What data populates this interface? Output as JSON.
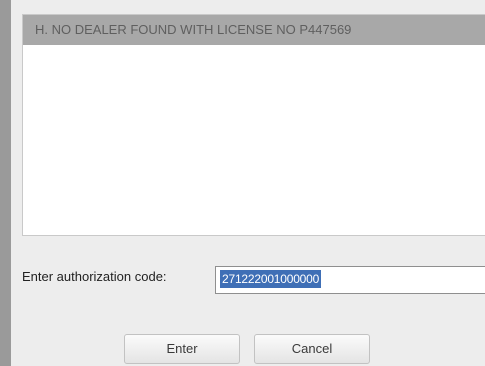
{
  "messages": {
    "items": [
      {
        "text": "H. NO DEALER FOUND WITH LICENSE NO P447569"
      }
    ]
  },
  "auth": {
    "label": "Enter authorization code:",
    "value": "271222001000000"
  },
  "buttons": {
    "enter": "Enter",
    "cancel": "Cancel"
  }
}
